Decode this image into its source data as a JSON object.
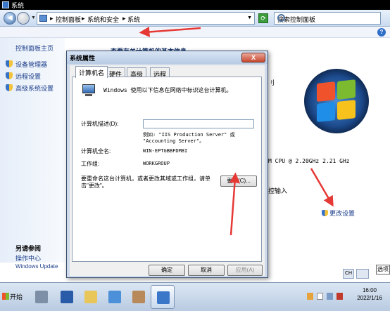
{
  "window": {
    "title": "系统"
  },
  "address": {
    "crumbs": [
      "控制面板",
      "系统和安全",
      "系统"
    ],
    "search_placeholder": "搜索控制面板"
  },
  "help_label": "?",
  "left_pane": {
    "home": "控制面板主页",
    "links": [
      "设备管理器",
      "远程设置",
      "高级系统设置"
    ],
    "see_also_title": "另请参阅",
    "see_also": [
      "操作中心",
      "Windows Update"
    ]
  },
  "main": {
    "title": "查看有关计算机的基本信息",
    "fragment_1": "刂",
    "cpu_text": "M CPU @ 2.20GHz   2.21 GHz",
    "pen_text": "控输入",
    "change_settings": "更改设置"
  },
  "dialog": {
    "title": "系统属性",
    "close": "X",
    "tabs": [
      "计算机名",
      "硬件",
      "高级",
      "远程"
    ],
    "active_tab": "计算机名",
    "intro": "Windows 使用以下信息在网络中标识这台计算机。",
    "desc_label": "计算机描述(D):",
    "desc_value": "",
    "example_1": "例如: \"IIS Production Server\" 或",
    "example_2": "\"Accounting Server\"。",
    "fullname_label": "计算机全名:",
    "fullname_value": "WIN-EPTGBBFDM8I",
    "workgroup_label": "工作组:",
    "workgroup_value": "WORKGROUP",
    "rename_text": "要重命名这台计算机，或者更改其域或工作组，请单击\"更改\"。",
    "change_button": "更改(C)...",
    "ok": "确定",
    "cancel": "取消",
    "apply": "应用(A)"
  },
  "lang_indicator": "CH",
  "options_label": "选项",
  "taskbar": {
    "start": "开始",
    "time": "16:00",
    "date": "2022/1/16"
  },
  "colors": {
    "arrow": "#e53935",
    "titlebar": "#000000",
    "dialog_frame": "#cfdbea"
  }
}
